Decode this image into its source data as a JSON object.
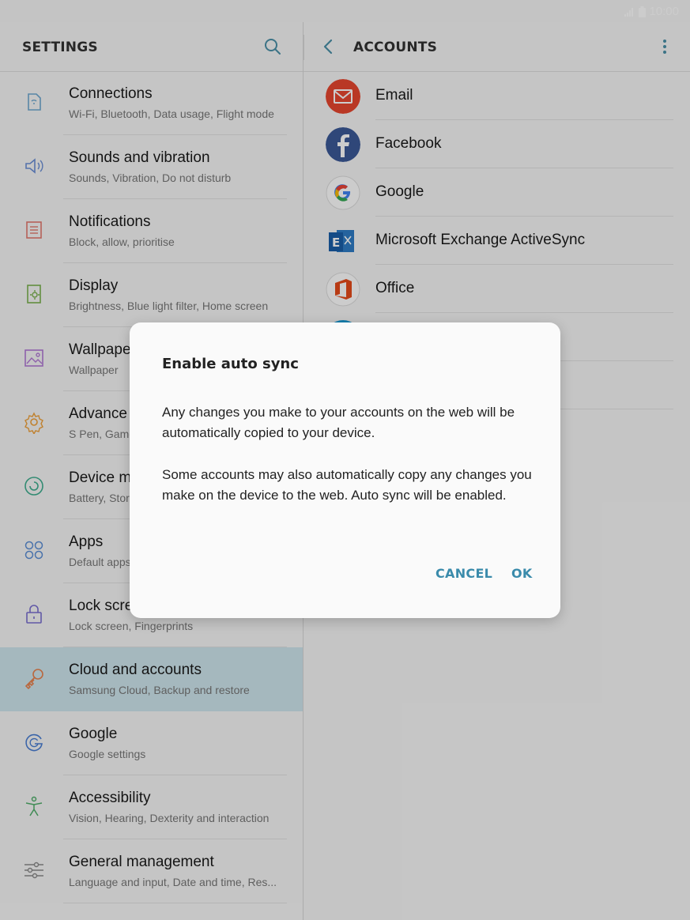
{
  "status_bar": {
    "time": "10:00"
  },
  "left_pane": {
    "title": "SETTINGS",
    "items": [
      {
        "title": "Connections",
        "subtitle": "Wi-Fi, Bluetooth, Data usage, Flight mode",
        "icon": "connections-icon"
      },
      {
        "title": "Sounds and vibration",
        "subtitle": "Sounds, Vibration, Do not disturb",
        "icon": "speaker-icon"
      },
      {
        "title": "Notifications",
        "subtitle": "Block, allow, prioritise",
        "icon": "notifications-icon"
      },
      {
        "title": "Display",
        "subtitle": "Brightness, Blue light filter, Home screen",
        "icon": "display-icon"
      },
      {
        "title": "Wallpape",
        "subtitle": "Wallpaper",
        "icon": "wallpaper-icon"
      },
      {
        "title": "Advance",
        "subtitle": "S Pen, Game",
        "icon": "gear-icon"
      },
      {
        "title": "Device m",
        "subtitle": "Battery, Stor",
        "icon": "device-maintenance-icon"
      },
      {
        "title": "Apps",
        "subtitle": "Default apps",
        "icon": "apps-icon"
      },
      {
        "title": "Lock scre",
        "subtitle": "Lock screen, Fingerprints",
        "icon": "lock-icon"
      },
      {
        "title": "Cloud and accounts",
        "subtitle": "Samsung Cloud, Backup and restore",
        "icon": "key-icon"
      },
      {
        "title": "Google",
        "subtitle": "Google settings",
        "icon": "google-g-icon"
      },
      {
        "title": "Accessibility",
        "subtitle": "Vision, Hearing, Dexterity and interaction",
        "icon": "accessibility-icon"
      },
      {
        "title": "General management",
        "subtitle": "Language and input, Date and time, Res...",
        "icon": "sliders-icon"
      }
    ]
  },
  "right_pane": {
    "title": "ACCOUNTS",
    "accounts": [
      {
        "label": "Email",
        "icon": "email-icon",
        "color": "#e8472f"
      },
      {
        "label": "Facebook",
        "icon": "facebook-icon",
        "color": "#3b5998"
      },
      {
        "label": "Google",
        "icon": "google-icon",
        "color": "#ffffff"
      },
      {
        "label": "Microsoft Exchange ActiveSync",
        "icon": "exchange-icon",
        "color": "#1f6fbf"
      },
      {
        "label": "Office",
        "icon": "office-icon",
        "color": "#e64a19"
      }
    ]
  },
  "dialog": {
    "title": "Enable auto sync",
    "paragraph1": "Any changes you make to your accounts on the web will be automatically copied to your device.",
    "paragraph2": "Some accounts may also automatically copy any changes you make on the device to the web. Auto sync will be enabled.",
    "cancel": "CANCEL",
    "ok": "OK"
  },
  "colors": {
    "accent": "#3a8bab",
    "selected_row": "#cfe6ee"
  }
}
